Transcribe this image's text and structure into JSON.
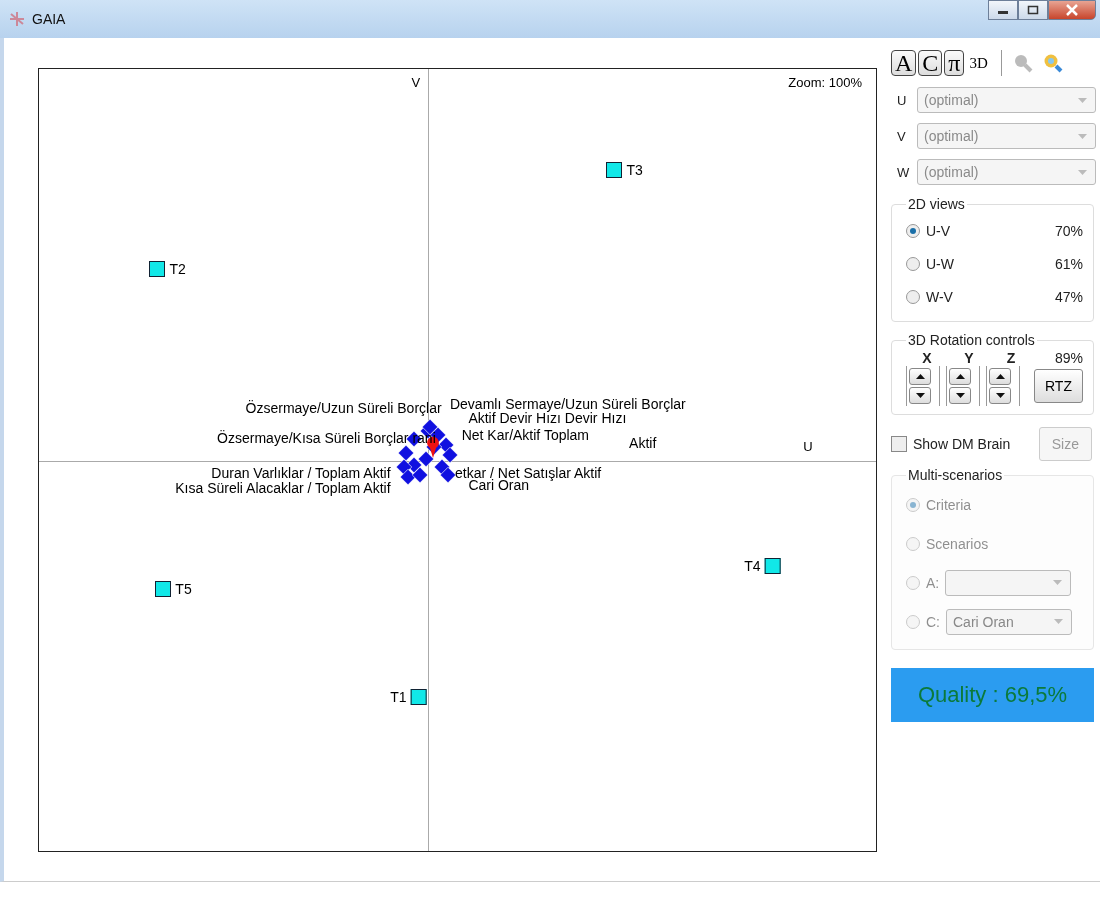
{
  "window": {
    "title": "GAIA"
  },
  "plot": {
    "axis_u": "U",
    "axis_v": "V",
    "zoom": "Zoom: 100%",
    "alternatives": [
      {
        "label": "T1"
      },
      {
        "label": "T2"
      },
      {
        "label": "T3"
      },
      {
        "label": "T4"
      },
      {
        "label": "T5"
      }
    ],
    "criteria_labels": [
      "Özsermaye/Uzun Süreli Borçlar",
      "Özsermaye/Kısa Süreli Borçlar rani",
      "Duran Varlıklar / Toplam Aktif",
      "Kısa Süreli Alacaklar / Toplam Aktif",
      "Devamlı Sermaye/Uzun Süreli Borçlar",
      "Aktif Devir Hızı Devir Hızı",
      "Net Kar/Aktif Toplam",
      "Aktif",
      "etkar / Net Satışlar Aktif",
      "Cari Oran"
    ]
  },
  "toolbar": [
    {
      "label": "A"
    },
    {
      "label": "C"
    },
    {
      "label": "π"
    },
    {
      "label": "3D"
    }
  ],
  "axis_selectors": [
    {
      "axis": "U",
      "value": "(optimal)"
    },
    {
      "axis": "V",
      "value": "(optimal)"
    },
    {
      "axis": "W",
      "value": "(optimal)"
    }
  ],
  "views_2d": {
    "title": "2D views",
    "options": [
      {
        "label": "U-V",
        "percent": "70%",
        "selected": true
      },
      {
        "label": "U-W",
        "percent": "61%",
        "selected": false
      },
      {
        "label": "W-V",
        "percent": "47%",
        "selected": false
      }
    ]
  },
  "rotation": {
    "title": "3D Rotation controls",
    "axes": [
      "X",
      "Y",
      "Z"
    ],
    "percent": "89%",
    "reset": "RTZ"
  },
  "dm_brain": {
    "label": "Show DM Brain",
    "checked": false,
    "size_button": "Size"
  },
  "multi_scenarios": {
    "title": "Multi-scenarios",
    "disabled": true,
    "options": [
      {
        "label": "Criteria",
        "selected": true
      },
      {
        "label": "Scenarios",
        "selected": false
      },
      {
        "label": "A:",
        "selected": false,
        "kind": "select"
      },
      {
        "label": "C:",
        "selected": false,
        "kind": "select",
        "value": "Cari Oran"
      }
    ]
  },
  "quality": "Quality : 69,5%"
}
